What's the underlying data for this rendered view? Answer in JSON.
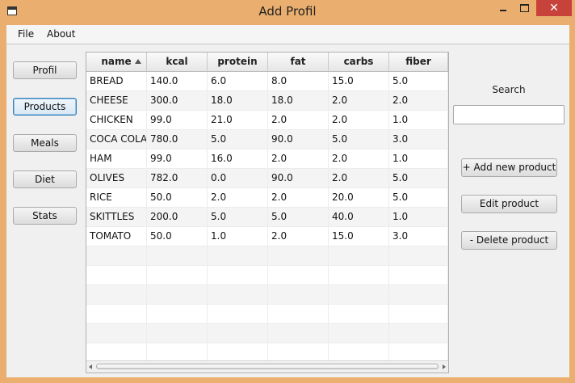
{
  "window": {
    "title": "Add Profil",
    "close_glyph": "✕"
  },
  "menu": {
    "file": "File",
    "about": "About"
  },
  "nav": {
    "profil": "Profil",
    "products": "Products",
    "meals": "Meals",
    "diet": "Diet",
    "stats": "Stats",
    "selected": "Products"
  },
  "table": {
    "columns": [
      "name",
      "kcal",
      "protein",
      "fat",
      "carbs",
      "fiber"
    ],
    "sort_column": "name",
    "sort_direction": "ascending",
    "rows": [
      [
        "BREAD",
        "140.0",
        "6.0",
        "8.0",
        "15.0",
        "5.0"
      ],
      [
        "CHEESE",
        "300.0",
        "18.0",
        "18.0",
        "2.0",
        "2.0"
      ],
      [
        "CHICKEN",
        "99.0",
        "21.0",
        "2.0",
        "2.0",
        "1.0"
      ],
      [
        "COCA COLA",
        "780.0",
        "5.0",
        "90.0",
        "5.0",
        "3.0"
      ],
      [
        "HAM",
        "99.0",
        "16.0",
        "2.0",
        "2.0",
        "1.0"
      ],
      [
        "OLIVES",
        "782.0",
        "0.0",
        "90.0",
        "2.0",
        "5.0"
      ],
      [
        "RICE",
        "50.0",
        "2.0",
        "2.0",
        "20.0",
        "5.0"
      ],
      [
        "SKITTLES",
        "200.0",
        "5.0",
        "5.0",
        "40.0",
        "1.0"
      ],
      [
        "TOMATO",
        "50.0",
        "1.0",
        "2.0",
        "15.0",
        "3.0"
      ]
    ]
  },
  "search": {
    "label": "Search",
    "value": "",
    "placeholder": ""
  },
  "actions": {
    "add": "+ Add new product",
    "edit": "Edit product",
    "delete": "- Delete product"
  },
  "colors": {
    "window_frame": "#eaaf6f",
    "close_button": "#c7423b",
    "selected_border": "#3c7fb1"
  }
}
